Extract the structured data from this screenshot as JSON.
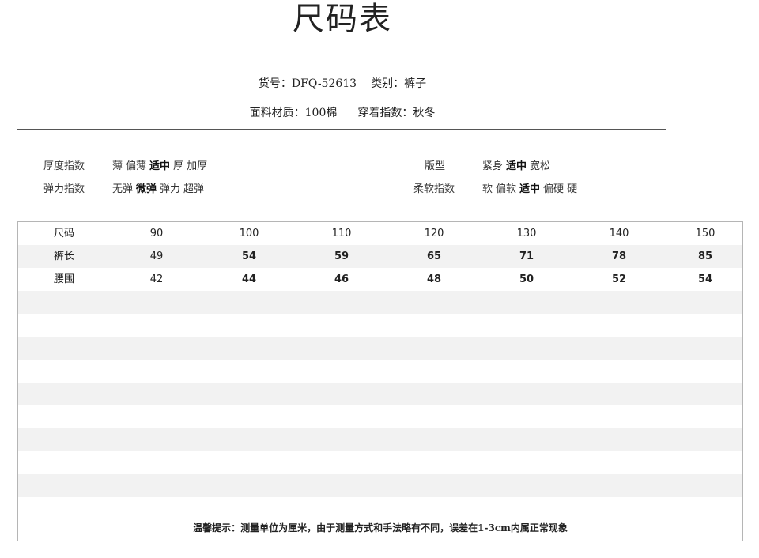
{
  "title": "尺码表",
  "meta": {
    "item_no": "货号：DFQ-52613",
    "category": "类别：裤子",
    "material": "面料材质：100棉",
    "wear_index": "穿着指数：秋冬"
  },
  "attributes": {
    "thickness": {
      "label": "厚度指数",
      "options": [
        "薄",
        "偏薄",
        "适中",
        "厚",
        "加厚"
      ],
      "selected": "适中"
    },
    "elasticity": {
      "label": "弹力指数",
      "options": [
        "无弹",
        "微弹",
        "弹力",
        "超弹"
      ],
      "selected": "微弹"
    },
    "fit": {
      "label": "版型",
      "options": [
        "紧身",
        "适中",
        "宽松"
      ],
      "selected": "适中"
    },
    "softness": {
      "label": "柔软指数",
      "options": [
        "软",
        "偏软",
        "适中",
        "偏硬",
        "硬"
      ],
      "selected": "适中"
    }
  },
  "table": {
    "rows": [
      {
        "label": "尺码",
        "values": [
          "90",
          "100",
          "110",
          "120",
          "130",
          "140",
          "150"
        ]
      },
      {
        "label": "裤长",
        "values": [
          "49",
          "54",
          "59",
          "65",
          "71",
          "78",
          "85"
        ]
      },
      {
        "label": "腰围",
        "values": [
          "42",
          "44",
          "46",
          "48",
          "50",
          "52",
          "54"
        ]
      }
    ],
    "empty_rows": 10
  },
  "note": "温馨提示：测量单位为厘米，由于测量方式和手法略有不同，误差在1-3cm内属正常现象"
}
